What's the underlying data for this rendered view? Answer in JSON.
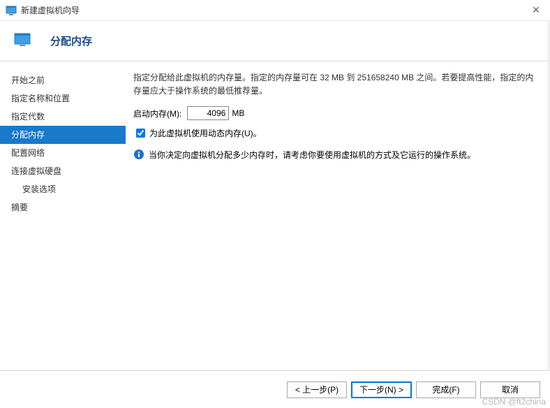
{
  "window": {
    "title": "新建虚拟机向导"
  },
  "header": {
    "title": "分配内存"
  },
  "sidebar": {
    "items": [
      {
        "label": "开始之前",
        "indent": false,
        "selected": false
      },
      {
        "label": "指定名称和位置",
        "indent": false,
        "selected": false
      },
      {
        "label": "指定代数",
        "indent": false,
        "selected": false
      },
      {
        "label": "分配内存",
        "indent": false,
        "selected": true
      },
      {
        "label": "配置网络",
        "indent": false,
        "selected": false
      },
      {
        "label": "连接虚拟硬盘",
        "indent": false,
        "selected": false
      },
      {
        "label": "安装选项",
        "indent": true,
        "selected": false
      },
      {
        "label": "摘要",
        "indent": false,
        "selected": false
      }
    ]
  },
  "main": {
    "description": "指定分配给此虚拟机的内存量。指定的内存量可在 32 MB 到 251658240 MB 之间。若要提高性能，指定的内存量应大于操作系统的最低推荐量。",
    "memory_label": "启动内存(M):",
    "memory_value": "4096",
    "memory_unit": "MB",
    "dynamic_checkbox_label": "为此虚拟机使用动态内存(U)。",
    "dynamic_checked": true,
    "info_text": "当你决定向虚拟机分配多少内存时，请考虑你要使用虚拟机的方式及它运行的操作系统。"
  },
  "footer": {
    "prev": "< 上一步(P)",
    "next": "下一步(N) >",
    "finish": "完成(F)",
    "cancel": "取消"
  },
  "watermark": "CSDN @ft2china"
}
